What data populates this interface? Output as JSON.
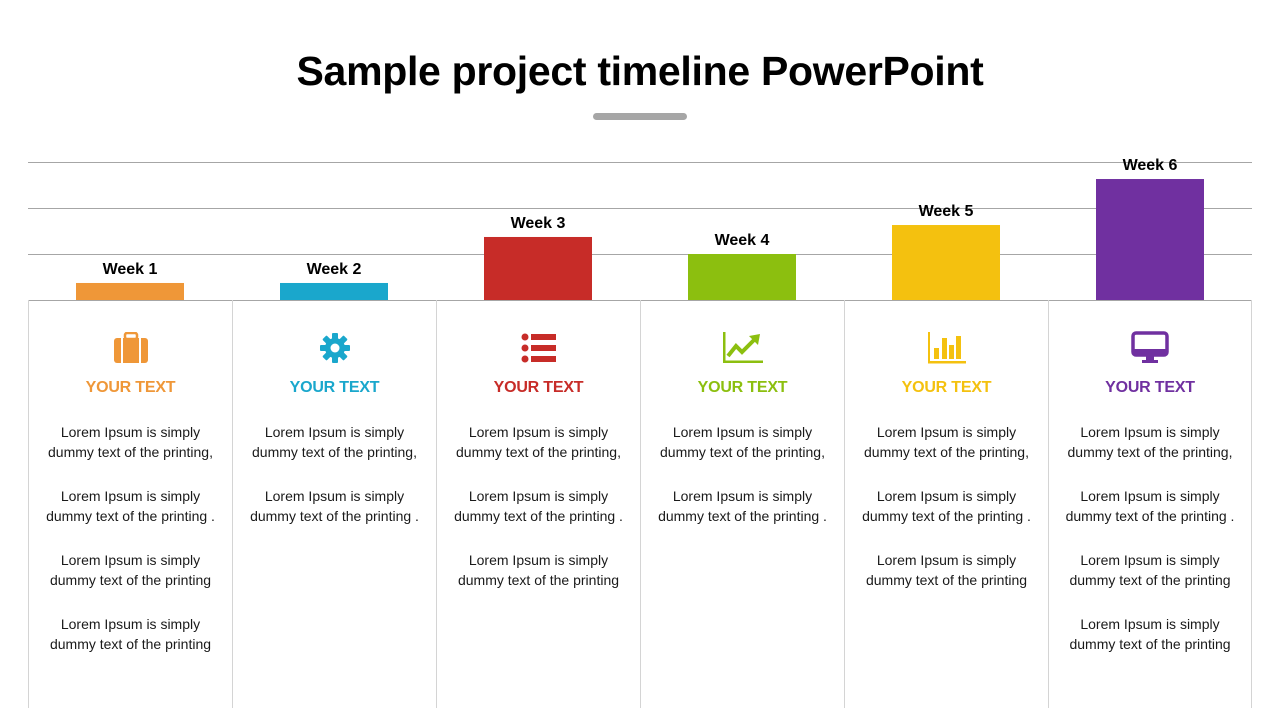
{
  "page": {
    "title": "Sample project timeline PowerPoint"
  },
  "chart_data": {
    "type": "bar",
    "title": "",
    "xlabel": "",
    "ylabel": "",
    "categories": [
      "Week 1",
      "Week 2",
      "Week 3",
      "Week 4",
      "Week 5",
      "Week 6"
    ],
    "values": [
      0.37,
      0.37,
      1.37,
      1.0,
      1.63,
      2.63
    ],
    "ylim": [
      0,
      3
    ],
    "grid": true,
    "gridlines": [
      1,
      2,
      3
    ],
    "colors": [
      "#EF9738",
      "#1AA7CC",
      "#C72C28",
      "#8CBF0F",
      "#F4C10F",
      "#7030A0"
    ],
    "data_labels": [
      "Week 1",
      "Week 2",
      "Week 3",
      "Week 4",
      "Week 5",
      "Week 6"
    ]
  },
  "columns": [
    {
      "icon": "briefcase-icon",
      "color": "#EF9738",
      "heading": "YOUR TEXT",
      "paragraphs": [
        "Lorem Ipsum is simply dummy text of the printing,",
        "Lorem Ipsum is simply dummy text of the printing .",
        "Lorem Ipsum is simply dummy text of the printing",
        "Lorem Ipsum is simply dummy text of the printing"
      ]
    },
    {
      "icon": "gear-icon",
      "color": "#1AA7CC",
      "heading": "YOUR TEXT",
      "paragraphs": [
        "Lorem Ipsum is simply dummy text of the printing,",
        "Lorem Ipsum is simply dummy text of the printing ."
      ]
    },
    {
      "icon": "list-icon",
      "color": "#C72C28",
      "heading": "YOUR TEXT",
      "paragraphs": [
        "Lorem Ipsum is simply dummy text of the printing,",
        "Lorem Ipsum is simply dummy text of the printing .",
        "Lorem Ipsum is simply dummy text of the printing"
      ]
    },
    {
      "icon": "line-chart-icon",
      "color": "#8CBF0F",
      "heading": "YOUR TEXT",
      "paragraphs": [
        "Lorem Ipsum is simply dummy text of the printing,",
        "Lorem Ipsum is simply dummy text of the printing ."
      ]
    },
    {
      "icon": "bar-chart-icon",
      "color": "#F4C10F",
      "heading": "YOUR TEXT",
      "paragraphs": [
        "Lorem Ipsum is simply dummy text of the printing,",
        "Lorem Ipsum is simply dummy text of the printing .",
        "Lorem Ipsum is simply dummy text of the printing"
      ]
    },
    {
      "icon": "monitor-icon",
      "color": "#7030A0",
      "heading": "YOUR TEXT",
      "paragraphs": [
        "Lorem Ipsum is simply dummy text of the printing,",
        "Lorem Ipsum is simply dummy text of the printing .",
        "Lorem Ipsum is simply dummy text of the printing",
        "Lorem Ipsum is simply dummy text of the printing"
      ]
    }
  ]
}
